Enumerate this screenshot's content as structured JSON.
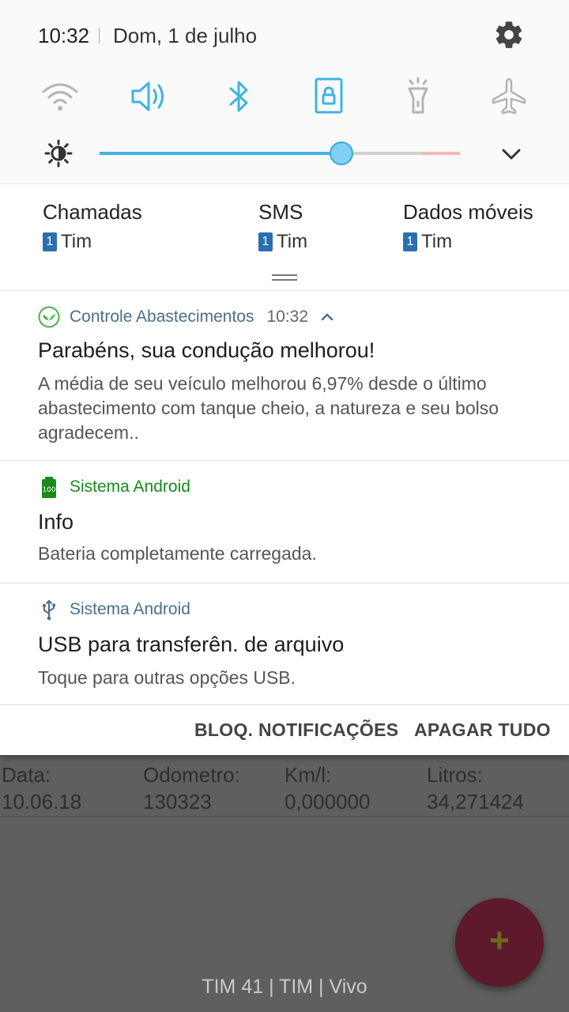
{
  "status_bar": {
    "time": "10:32",
    "date": "Dom, 1 de julho"
  },
  "quick_settings": {
    "toggles": [
      {
        "name": "wifi",
        "active": false
      },
      {
        "name": "sound",
        "active": true
      },
      {
        "name": "bluetooth",
        "active": true
      },
      {
        "name": "screen-rotation-lock",
        "active": true
      },
      {
        "name": "flashlight",
        "active": false
      },
      {
        "name": "airplane-mode",
        "active": false
      }
    ],
    "brightness_level": 0.67,
    "accent_color": "#3db4e3"
  },
  "sim_settings": [
    {
      "label": "Chamadas",
      "sim_number": "1",
      "carrier": "Tim"
    },
    {
      "label": "SMS",
      "sim_number": "1",
      "carrier": "Tim"
    },
    {
      "label": "Dados móveis",
      "sim_number": "1",
      "carrier": "Tim"
    }
  ],
  "notifications": [
    {
      "app": "Controle Abastecimentos",
      "time": "10:32",
      "title": "Parabéns, sua condução melhorou!",
      "body": "A média de seu veículo melhorou 6,97% desde o último abastecimento com tanque cheio, a natureza e seu bolso agradecem..",
      "app_color": "#4a6f8a"
    },
    {
      "app": "Sistema Android",
      "title": "Info",
      "body": "Bateria completamente carregada.",
      "app_color": "#1b8a1b"
    },
    {
      "app": "Sistema Android",
      "title": "USB para transferên. de arquivo",
      "body": "Toque para outras opções USB.",
      "app_color": "#4a6f8a"
    }
  ],
  "actions": {
    "block": "BLOQ. NOTIFICAÇÕES",
    "clear": "APAGAR TUDO"
  },
  "background_app": {
    "headers": [
      "Data:",
      "Odometro:",
      "Km/l:",
      "Litros:"
    ],
    "row": [
      "10.06.18",
      "130323",
      "0,000000",
      "34,271424"
    ],
    "fab_label": "+",
    "carrier_text": "TIM 41 | TIM | Vivo"
  }
}
